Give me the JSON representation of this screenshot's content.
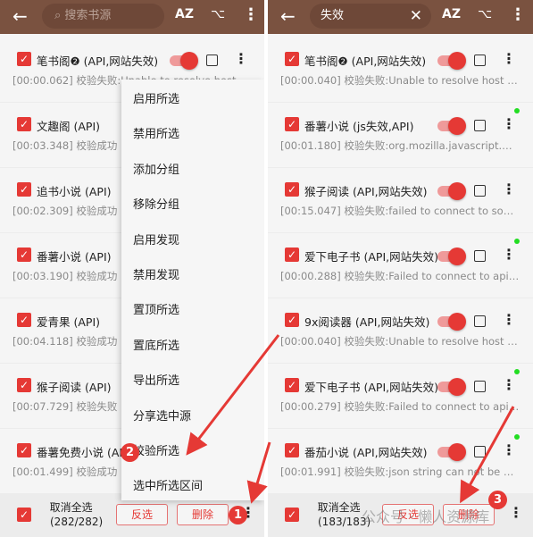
{
  "left": {
    "search_placeholder": "搜索书源",
    "rows": [
      {
        "title": "笔书阁❷ (API,网站失效)",
        "detail": "[00:00.062] 校验失败:Unable to resolve host \"m.d..."
      },
      {
        "title": "文趣阁 (API)",
        "detail": "[00:03.348] 校验成功"
      },
      {
        "title": "追书小说 (API)",
        "detail": "[00:02.309] 校验成功"
      },
      {
        "title": "番薯小说 (API)",
        "detail": "[00:03.190] 校验成功"
      },
      {
        "title": "爱青果 (API)",
        "detail": "[00:04.118] 校验成功"
      },
      {
        "title": "猴子阅读 (API)",
        "detail": "[00:07.729] 校验失败"
      },
      {
        "title": "番薯免费小说 (API)",
        "detail": "[00:01.499] 校验成功"
      }
    ],
    "menu": [
      "启用所选",
      "禁用所选",
      "添加分组",
      "移除分组",
      "启用发现",
      "禁用发现",
      "置顶所选",
      "置底所选",
      "导出所选",
      "分享选中源",
      "校验所选",
      "选中所选区间"
    ],
    "bottom": {
      "select_label": "取消全选",
      "count": "(282/282)",
      "invert": "反选",
      "delete": "删除"
    }
  },
  "right": {
    "search_value": "失效",
    "rows": [
      {
        "title": "笔书阁❷ (API,网站失效)",
        "detail": "[00:00.040] 校验失败:Unable to resolve host \"m.d...",
        "dot": false
      },
      {
        "title": "番薯小说 (js失效,API)",
        "detail": "[00:01.180] 校验失败:org.mozilla.javascript.Wrap...",
        "dot": true
      },
      {
        "title": "猴子阅读 (API,网站失效)",
        "detail": "[00:15.047] 校验失败:failed to connect to souxs.le...",
        "dot": false
      },
      {
        "title": "爱下电子书 (API,网站失效)",
        "detail": "[00:00.288] 校验失败:Failed to connect to api.aix...",
        "dot": true
      },
      {
        "title": "9x阅读器 (API,网站失效)",
        "detail": "[00:00.040] 校验失败:Unable to resolve host \"nov...",
        "dot": false
      },
      {
        "title": "爱下电子书 (API,网站失效)",
        "detail": "[00:00.279] 校验失败:Failed to connect to api.aix...",
        "dot": true
      },
      {
        "title": "番茄小说 (API,网站失效)",
        "detail": "[00:01.991] 校验失败:json string can not be null o...",
        "dot": true
      }
    ],
    "bottom": {
      "select_label": "取消全选",
      "count": "(183/183)",
      "invert": "反选",
      "delete": "删除"
    }
  },
  "toolbar": {
    "back": "←",
    "sort": "AZ",
    "group": "⌥",
    "more": "⋮",
    "clear": "✕",
    "search_icon": "⌕"
  },
  "annotations": [
    "1",
    "2",
    "3"
  ],
  "watermark": "公众号 · 懒人资源库",
  "colors": {
    "toolbar": "#7a5240",
    "accent": "#e53935",
    "dot": "#22dd22"
  }
}
